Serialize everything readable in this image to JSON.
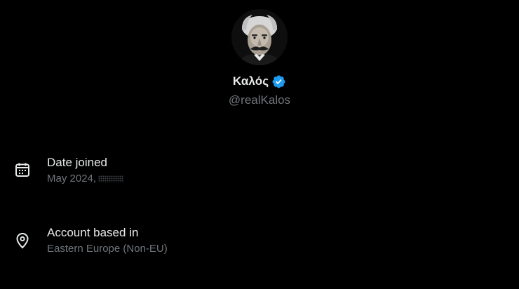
{
  "profile": {
    "display_name": "Καλός",
    "handle": "@realKalos",
    "verified": true,
    "verified_color": "#1d9bf0",
    "avatar_icon": "avatar-portrait"
  },
  "details": {
    "joined": {
      "title": "Date joined",
      "value": "May 2024,",
      "icon": "calendar-icon"
    },
    "based": {
      "title": "Account based in",
      "value": "Eastern Europe (Non-EU)",
      "icon": "location-pin-icon"
    }
  }
}
